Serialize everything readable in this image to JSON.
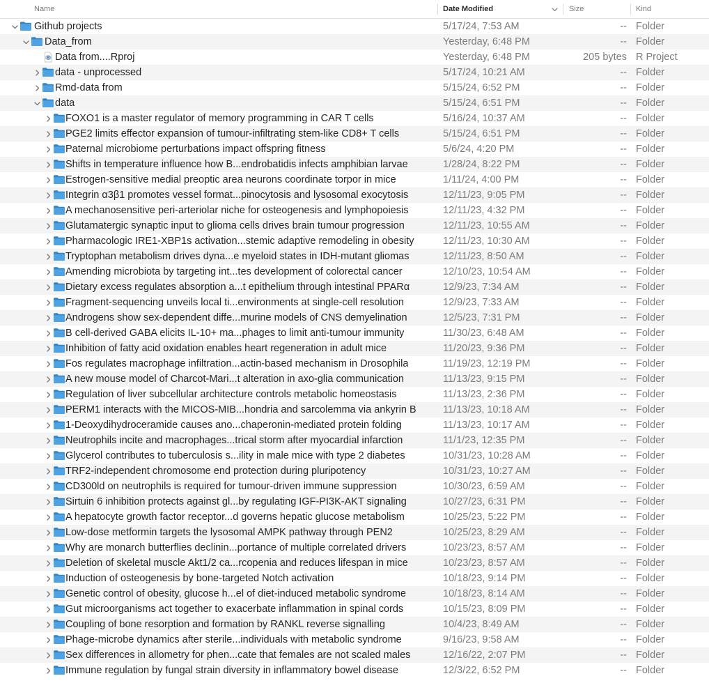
{
  "columns": {
    "name": "Name",
    "date_modified": "Date Modified",
    "size": "Size",
    "kind": "Kind",
    "sort_column": "date_modified",
    "sort_direction": "descending"
  },
  "colors": {
    "folder_icon": "#4fa3e3",
    "folder_icon_dark": "#2f86cf",
    "row_stripe": "#f4f4f5",
    "text": "#262626",
    "muted_text": "#7c7c7c"
  },
  "rows": [
    {
      "name": "Github projects",
      "date": "5/17/24, 7:53 AM",
      "size": "--",
      "kind": "Folder",
      "depth": 0,
      "type": "folder",
      "expanded": true
    },
    {
      "name": "Data_from",
      "date": "Yesterday, 6:48 PM",
      "size": "--",
      "kind": "Folder",
      "depth": 1,
      "type": "folder",
      "expanded": true
    },
    {
      "name": "Data from....Rproj",
      "date": "Yesterday, 6:48 PM",
      "size": "205 bytes",
      "kind": "R Project",
      "depth": 2,
      "type": "file",
      "icon": "rproj-file-icon"
    },
    {
      "name": "data - unprocessed",
      "date": "5/17/24, 10:21 AM",
      "size": "--",
      "kind": "Folder",
      "depth": 2,
      "type": "folder",
      "expanded": false
    },
    {
      "name": "Rmd-data from",
      "date": "5/15/24, 6:52 PM",
      "size": "--",
      "kind": "Folder",
      "depth": 2,
      "type": "folder",
      "expanded": false
    },
    {
      "name": "data",
      "date": "5/15/24, 6:51 PM",
      "size": "--",
      "kind": "Folder",
      "depth": 2,
      "type": "folder",
      "expanded": true
    },
    {
      "name": "FOXO1 is a master regulator of memory programming in CAR T cells",
      "date": "5/16/24, 10:37 AM",
      "size": "--",
      "kind": "Folder",
      "depth": 3,
      "type": "folder",
      "expanded": false
    },
    {
      "name": "PGE2 limits effector expansion of tumour-infiltrating stem-like CD8+ T cells",
      "date": "5/15/24, 6:51 PM",
      "size": "--",
      "kind": "Folder",
      "depth": 3,
      "type": "folder",
      "expanded": false
    },
    {
      "name": "Paternal microbiome perturbations impact offspring fitness",
      "date": "5/6/24, 4:20 PM",
      "size": "--",
      "kind": "Folder",
      "depth": 3,
      "type": "folder",
      "expanded": false
    },
    {
      "name": "Shifts in temperature influence how B...endrobatidis infects amphibian larvae",
      "date": "1/28/24, 8:22 PM",
      "size": "--",
      "kind": "Folder",
      "depth": 3,
      "type": "folder",
      "expanded": false
    },
    {
      "name": "Estrogen-sensitive medial preoptic area neurons coordinate torpor in mice",
      "date": "1/11/24, 4:00 PM",
      "size": "--",
      "kind": "Folder",
      "depth": 3,
      "type": "folder",
      "expanded": false
    },
    {
      "name": "Integrin α3β1 promotes vessel format...pinocytosis and lysosomal exocytosis",
      "date": "12/11/23, 9:05 PM",
      "size": "--",
      "kind": "Folder",
      "depth": 3,
      "type": "folder",
      "expanded": false
    },
    {
      "name": "A mechanosensitive peri-arteriolar niche for osteogenesis and lymphopoiesis",
      "date": "12/11/23, 4:32 PM",
      "size": "--",
      "kind": "Folder",
      "depth": 3,
      "type": "folder",
      "expanded": false
    },
    {
      "name": "Glutamatergic synaptic input to glioma cells drives brain tumour progression",
      "date": "12/11/23, 10:55 AM",
      "size": "--",
      "kind": "Folder",
      "depth": 3,
      "type": "folder",
      "expanded": false
    },
    {
      "name": "Pharmacologic IRE1-XBP1s activation...stemic adaptive remodeling in obesity",
      "date": "12/11/23, 10:30 AM",
      "size": "--",
      "kind": "Folder",
      "depth": 3,
      "type": "folder",
      "expanded": false
    },
    {
      "name": "Tryptophan metabolism drives dyna...e myeloid states in IDH-mutant gliomas",
      "date": "12/11/23, 8:50 AM",
      "size": "--",
      "kind": "Folder",
      "depth": 3,
      "type": "folder",
      "expanded": false
    },
    {
      "name": "Amending microbiota by targeting int...tes development of colorectal cancer",
      "date": "12/10/23, 10:54 AM",
      "size": "--",
      "kind": "Folder",
      "depth": 3,
      "type": "folder",
      "expanded": false
    },
    {
      "name": "Dietary excess regulates absorption a...t epithelium through intestinal PPARα",
      "date": "12/9/23, 7:34 AM",
      "size": "--",
      "kind": "Folder",
      "depth": 3,
      "type": "folder",
      "expanded": false
    },
    {
      "name": "Fragment-sequencing unveils local ti...environments at single-cell resolution",
      "date": "12/9/23, 7:33 AM",
      "size": "--",
      "kind": "Folder",
      "depth": 3,
      "type": "folder",
      "expanded": false
    },
    {
      "name": "Androgens show sex-dependent diffe...murine models of CNS demyelination",
      "date": "12/5/23, 7:31 PM",
      "size": "--",
      "kind": "Folder",
      "depth": 3,
      "type": "folder",
      "expanded": false
    },
    {
      "name": "B cell-derived GABA elicits IL-10+ ma...phages to limit anti-tumour immunity",
      "date": "11/30/23, 6:48 AM",
      "size": "--",
      "kind": "Folder",
      "depth": 3,
      "type": "folder",
      "expanded": false
    },
    {
      "name": "Inhibition of fatty acid oxidation enables heart regeneration in adult mice",
      "date": "11/20/23, 9:36 PM",
      "size": "--",
      "kind": "Folder",
      "depth": 3,
      "type": "folder",
      "expanded": false
    },
    {
      "name": "Fos regulates macrophage infiltration...actin-based mechanism in Drosophila",
      "date": "11/19/23, 12:19 PM",
      "size": "--",
      "kind": "Folder",
      "depth": 3,
      "type": "folder",
      "expanded": false
    },
    {
      "name": "A new mouse model of Charcot-Mari...t alteration in axo-glia communication",
      "date": "11/13/23, 9:15 PM",
      "size": "--",
      "kind": "Folder",
      "depth": 3,
      "type": "folder",
      "expanded": false
    },
    {
      "name": "Regulation of liver subcellular architecture controls metabolic homeostasis",
      "date": "11/13/23, 2:36 PM",
      "size": "--",
      "kind": "Folder",
      "depth": 3,
      "type": "folder",
      "expanded": false
    },
    {
      "name": "PERM1 interacts with the MICOS-MIB...hondria and sarcolemma via ankyrin B",
      "date": "11/13/23, 10:18 AM",
      "size": "--",
      "kind": "Folder",
      "depth": 3,
      "type": "folder",
      "expanded": false
    },
    {
      "name": "1-Deoxydihydroceramide causes ano...chaperonin-mediated protein folding",
      "date": "11/13/23, 10:17 AM",
      "size": "--",
      "kind": "Folder",
      "depth": 3,
      "type": "folder",
      "expanded": false
    },
    {
      "name": "Neutrophils incite and macrophages...trical storm after myocardial infarction",
      "date": "11/1/23, 12:35 PM",
      "size": "--",
      "kind": "Folder",
      "depth": 3,
      "type": "folder",
      "expanded": false
    },
    {
      "name": "Glycerol contributes to tuberculosis s...ility in male mice with type 2 diabetes",
      "date": "10/31/23, 10:28 AM",
      "size": "--",
      "kind": "Folder",
      "depth": 3,
      "type": "folder",
      "expanded": false
    },
    {
      "name": "TRF2-independent chromosome end protection during pluripotency",
      "date": "10/31/23, 10:27 AM",
      "size": "--",
      "kind": "Folder",
      "depth": 3,
      "type": "folder",
      "expanded": false
    },
    {
      "name": "CD300ld on neutrophils is required for tumour-driven immune suppression",
      "date": "10/30/23, 6:59 AM",
      "size": "--",
      "kind": "Folder",
      "depth": 3,
      "type": "folder",
      "expanded": false
    },
    {
      "name": "Sirtuin 6 inhibition protects against gl...by regulating IGF-PI3K-AKT signaling",
      "date": "10/27/23, 6:31 PM",
      "size": "--",
      "kind": "Folder",
      "depth": 3,
      "type": "folder",
      "expanded": false
    },
    {
      "name": "A hepatocyte growth factor receptor...d governs hepatic glucose metabolism",
      "date": "10/25/23, 5:22 PM",
      "size": "--",
      "kind": "Folder",
      "depth": 3,
      "type": "folder",
      "expanded": false
    },
    {
      "name": "Low-dose metformin targets the lysosomal AMPK pathway through PEN2",
      "date": "10/25/23, 8:29 AM",
      "size": "--",
      "kind": "Folder",
      "depth": 3,
      "type": "folder",
      "expanded": false
    },
    {
      "name": "Why are monarch butterflies declinin...portance of multiple correlated drivers",
      "date": "10/23/23, 8:57 AM",
      "size": "--",
      "kind": "Folder",
      "depth": 3,
      "type": "folder",
      "expanded": false
    },
    {
      "name": "Deletion of skeletal muscle Akt1/2 ca...rcopenia and reduces lifespan in mice",
      "date": "10/23/23, 8:57 AM",
      "size": "--",
      "kind": "Folder",
      "depth": 3,
      "type": "folder",
      "expanded": false
    },
    {
      "name": "Induction of osteogenesis by bone-targeted Notch activation",
      "date": "10/18/23, 9:14 PM",
      "size": "--",
      "kind": "Folder",
      "depth": 3,
      "type": "folder",
      "expanded": false
    },
    {
      "name": "Genetic control of obesity, glucose h...el of diet-induced metabolic syndrome",
      "date": "10/18/23, 8:14 AM",
      "size": "--",
      "kind": "Folder",
      "depth": 3,
      "type": "folder",
      "expanded": false
    },
    {
      "name": "Gut microorganisms act together to exacerbate inflammation in spinal cords",
      "date": "10/15/23, 8:09 PM",
      "size": "--",
      "kind": "Folder",
      "depth": 3,
      "type": "folder",
      "expanded": false
    },
    {
      "name": "Coupling of bone resorption and formation by RANKL reverse signalling",
      "date": "10/4/23, 8:49 AM",
      "size": "--",
      "kind": "Folder",
      "depth": 3,
      "type": "folder",
      "expanded": false
    },
    {
      "name": "Phage-microbe dynamics after sterile...individuals with metabolic syndrome",
      "date": "9/16/23, 9:58 AM",
      "size": "--",
      "kind": "Folder",
      "depth": 3,
      "type": "folder",
      "expanded": false
    },
    {
      "name": "Sex differences in allometry for phen...cate that females are not scaled males",
      "date": "12/16/22, 2:07 PM",
      "size": "--",
      "kind": "Folder",
      "depth": 3,
      "type": "folder",
      "expanded": false
    },
    {
      "name": "Immune regulation by fungal strain diversity in inflammatory bowel disease",
      "date": "12/3/22, 6:52 PM",
      "size": "--",
      "kind": "Folder",
      "depth": 3,
      "type": "folder",
      "expanded": false
    }
  ]
}
